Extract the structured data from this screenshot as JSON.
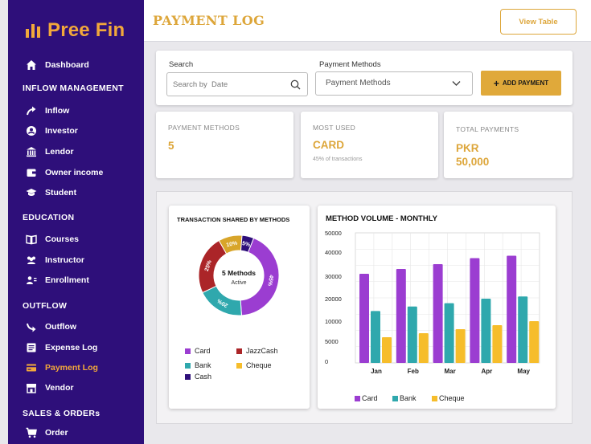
{
  "brand": {
    "name": "Pree Fin",
    "color": "#f2a83b"
  },
  "sidebar": {
    "dashboard": {
      "label": "Dashboard",
      "icon": "home-icon"
    },
    "sections": [
      {
        "title": "INFLOW MANAGEMENT",
        "items": [
          {
            "label": "Inflow",
            "icon": "arrow-icon"
          },
          {
            "label": "Investor",
            "icon": "user-circle-icon"
          },
          {
            "label": "Lendor",
            "icon": "bank-icon"
          },
          {
            "label": "Owner income",
            "icon": "wallet-icon"
          },
          {
            "label": "Student",
            "icon": "graduation-cap-icon"
          }
        ]
      },
      {
        "title": "EDUCATION",
        "items": [
          {
            "label": "Courses",
            "icon": "book-icon"
          },
          {
            "label": "Instructor",
            "icon": "users-icon"
          },
          {
            "label": "Enrollment",
            "icon": "user-list-icon"
          }
        ]
      },
      {
        "title": "OUTFLOW",
        "items": [
          {
            "label": "Outflow",
            "icon": "redo-arrow-icon"
          },
          {
            "label": "Expense Log",
            "icon": "document-icon"
          },
          {
            "label": "Payment Log",
            "icon": "credit-card-icon",
            "active": true
          },
          {
            "label": "Vendor",
            "icon": "store-icon"
          }
        ]
      },
      {
        "title": "SALES & ORDERs",
        "items": [
          {
            "label": "Order",
            "icon": "cart-icon"
          }
        ]
      }
    ]
  },
  "header": {
    "title": "PAYMENT LOG",
    "view_table_label": "View Table"
  },
  "filters": {
    "search_label": "Search",
    "search_placeholder": "Search by  Date",
    "methods_label": "Payment Methods",
    "methods_value": "Payment Methods",
    "add_label": "ADD PAYMENT"
  },
  "stats": {
    "methods": {
      "title": "PAYMENT METHODS",
      "value": "5"
    },
    "most_used": {
      "title": "MOST USED",
      "value": "CARD",
      "sub": "45% of transactions"
    },
    "total": {
      "title": "TOTAL PAYMENTS",
      "value_line1": "PKR",
      "value_line2": "50,000"
    }
  },
  "colors": {
    "accent": "#dda63a",
    "sidebar_bg": "#2e0f7a",
    "card": "#9b3dd1",
    "bank": "#2fa8ad",
    "cheque": "#f6bd2b",
    "jazzcash": "#ab2528",
    "cash": "#2e0f7a",
    "donut_jazz": "#ab2528"
  },
  "chart_data": [
    {
      "type": "pie",
      "title": "TRANSACTION SHARED BY METHODS",
      "center_label": "5 Methods",
      "center_sub": "Active",
      "slices": [
        {
          "name": "Card",
          "value": 45,
          "label": "45%",
          "color": "#9b3dd1"
        },
        {
          "name": "Bank",
          "value": 20,
          "label": "20%",
          "color": "#2fa8ad"
        },
        {
          "name": "JazzCash",
          "value": 25,
          "label": "25%",
          "color": "#ab2528"
        },
        {
          "name": "Cheque",
          "value": 10,
          "label": "10%",
          "color": "#d8a52a"
        },
        {
          "name": "Cash",
          "value": 5,
          "label": "5%",
          "color": "#2e0f7a"
        }
      ],
      "legend": [
        "Card",
        "JazzCash",
        "Bank",
        "Cheque",
        "Cash"
      ]
    },
    {
      "type": "bar",
      "title": "METHOD VOLUME - MONTHLY",
      "categories": [
        "Jan",
        "Feb",
        "Mar",
        "Apr",
        "May"
      ],
      "yticks": [
        0,
        5000,
        10000,
        20000,
        30000,
        40000,
        50000
      ],
      "series": [
        {
          "name": "Card",
          "values": [
            31000,
            33000,
            35000,
            37500,
            38500
          ],
          "color": "#9b3dd1"
        },
        {
          "name": "Bank",
          "values": [
            14500,
            16500,
            18000,
            20000,
            21000
          ],
          "color": "#2fa8ad"
        },
        {
          "name": "Cheque",
          "values": [
            6000,
            7000,
            8000,
            9000,
            10000
          ],
          "color": "#f6bd2b"
        }
      ],
      "grid": true,
      "legend_position": "bottom"
    }
  ]
}
